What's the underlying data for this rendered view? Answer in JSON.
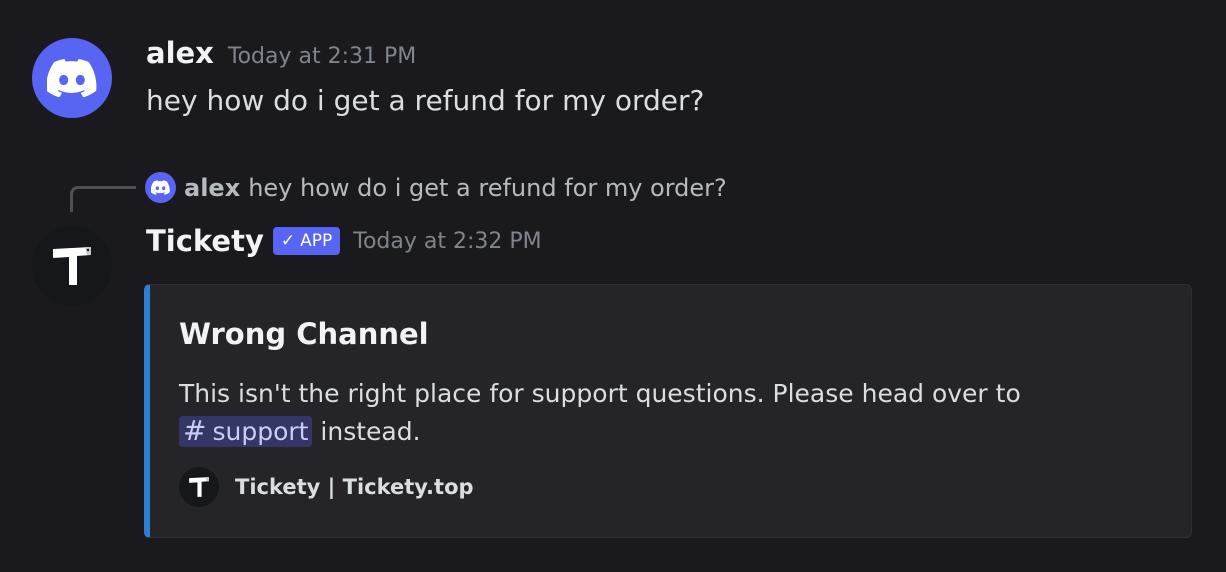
{
  "message": {
    "author": "alex",
    "timestamp": "Today at 2:31 PM",
    "text": "hey how do i get a refund for my order?",
    "avatar_icon": "discord-logo-icon",
    "avatar_color": "#5865f2"
  },
  "reply": {
    "author": "alex",
    "text": "hey how do i get a refund for my order?"
  },
  "bot_message": {
    "author": "Tickety",
    "badge": "APP",
    "badge_check": "✓",
    "timestamp": "Today at 2:32 PM",
    "avatar_icon": "tickety-logo-icon",
    "embed": {
      "accent_color": "#2e7fd1",
      "title": "Wrong Channel",
      "description_line1": "This isn't the right place for support questions. Please head over to",
      "channel_hash": "#",
      "channel_name": "support",
      "description_tail": " instead.",
      "footer": "Tickety | Tickety.top"
    }
  }
}
